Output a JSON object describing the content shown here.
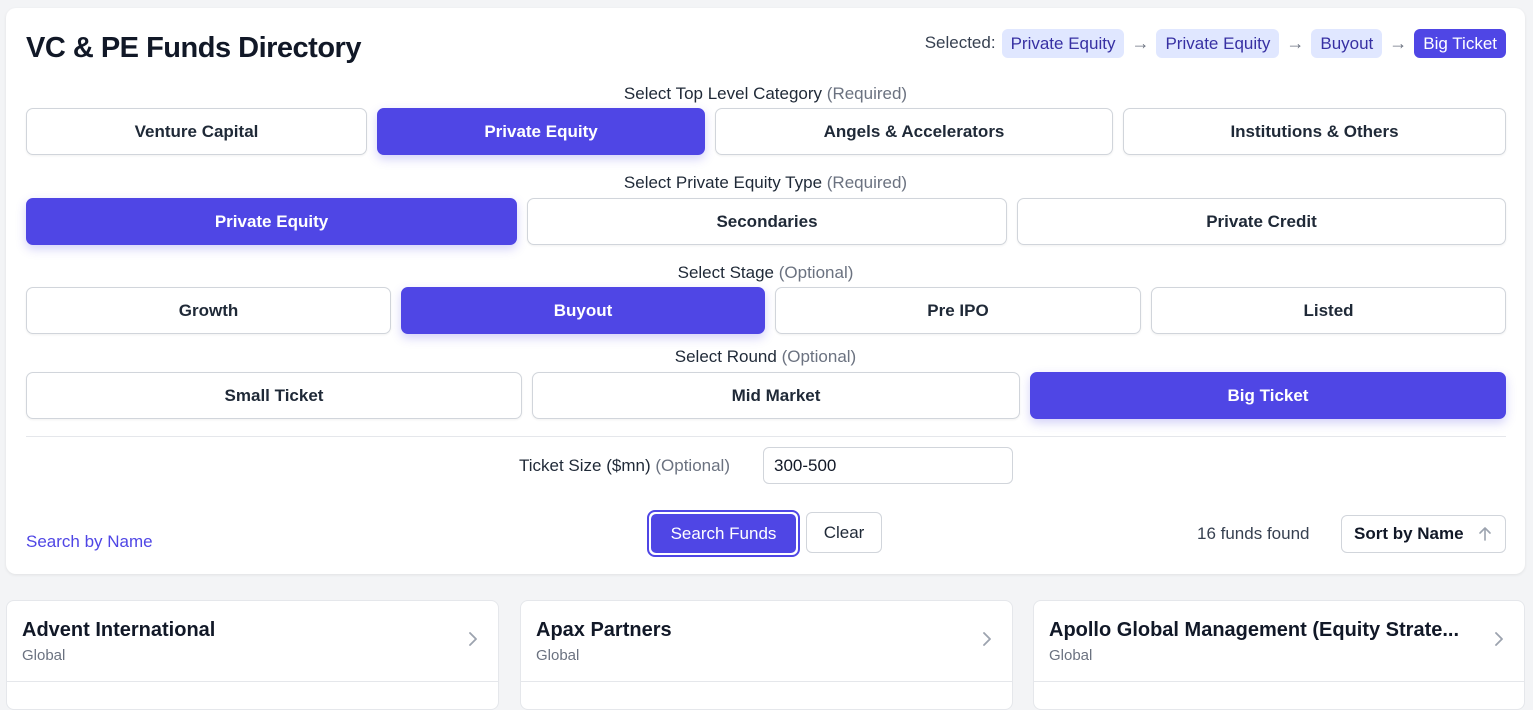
{
  "header": {
    "title": "VC & PE Funds Directory",
    "selected_label": "Selected:",
    "selected_path": [
      "Private Equity",
      "Private Equity",
      "Buyout",
      "Big Ticket"
    ],
    "arrow": "→"
  },
  "top_level": {
    "label": "Select Top Level Category",
    "qualifier": "(Required)",
    "options": [
      "Venture Capital",
      "Private Equity",
      "Angels & Accelerators",
      "Institutions & Others"
    ],
    "selected": "Private Equity"
  },
  "pe_type": {
    "label": "Select Private Equity Type",
    "qualifier": "(Required)",
    "options": [
      "Private Equity",
      "Secondaries",
      "Private Credit"
    ],
    "selected": "Private Equity"
  },
  "stage": {
    "label": "Select Stage",
    "qualifier": "(Optional)",
    "options": [
      "Growth",
      "Buyout",
      "Pre IPO",
      "Listed"
    ],
    "selected": "Buyout"
  },
  "round": {
    "label": "Select Round",
    "qualifier": "(Optional)",
    "options": [
      "Small Ticket",
      "Mid Market",
      "Big Ticket"
    ],
    "selected": "Big Ticket"
  },
  "ticket": {
    "label": "Ticket Size ($mn)",
    "qualifier": "(Optional)",
    "value": "300-500"
  },
  "actions": {
    "search_by_name": "Search by Name",
    "search_label": "Search Funds",
    "clear_label": "Clear",
    "count_text": "16 funds found",
    "sort_label": "Sort by Name"
  },
  "funds": [
    {
      "name": "Advent International",
      "region": "Global"
    },
    {
      "name": "Apax Partners",
      "region": "Global"
    },
    {
      "name": "Apollo Global Management (Equity Strate...",
      "region": "Global"
    }
  ],
  "colors": {
    "accent": "#4f46e5",
    "chip_bg": "#e0e7ff",
    "page_bg": "#f3f4f6"
  }
}
